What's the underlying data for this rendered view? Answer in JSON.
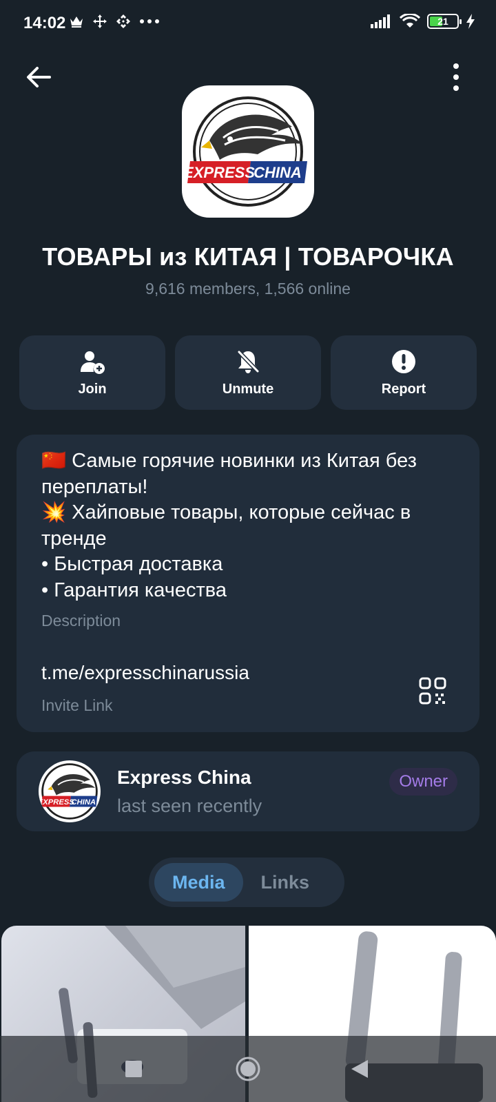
{
  "status_bar": {
    "time": "14:02",
    "left_icons": [
      "crown-icon",
      "move-icon",
      "binance-icon",
      "more-dots"
    ],
    "battery_level": "21"
  },
  "header": {
    "back_icon": "arrow-left-icon",
    "menu_icon": "more-vertical-icon"
  },
  "channel": {
    "logo_text_1": "EXPRESS",
    "logo_text_2": "CHINA",
    "title": "ТОВАРЫ из КИТАЯ | ТОВАРОЧКА",
    "subtitle": "9,616 members, 1,566 online"
  },
  "actions": [
    {
      "label": "Join",
      "icon": "add-user-icon"
    },
    {
      "label": "Unmute",
      "icon": "bell-off-icon"
    },
    {
      "label": "Report",
      "icon": "alert-icon"
    }
  ],
  "info": {
    "description": "🇨🇳 Самые горячие новинки из Китая без переплаты!\n💥 Хайповые товары, которые сейчас в тренде\n• Быстрая доставка\n• Гарантия качества",
    "description_caption": "Description",
    "link": "t.me/expresschinarussia",
    "link_caption": "Invite Link"
  },
  "owner": {
    "name": "Express China",
    "status": "last seen recently",
    "badge": "Owner"
  },
  "tabs": [
    {
      "label": "Media",
      "active": true
    },
    {
      "label": "Links",
      "active": false
    }
  ],
  "colors": {
    "background": "#182129",
    "card": "#212d3b",
    "accent": "#6cb6f0",
    "owner_badge": "#a47ce8"
  }
}
